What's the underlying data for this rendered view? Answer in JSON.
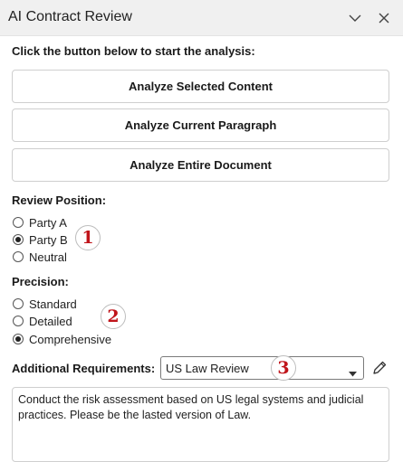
{
  "window": {
    "title": "AI Contract Review",
    "icons": [
      "chevron-down-icon",
      "close-icon"
    ]
  },
  "instruction": "Click the button below to start the analysis:",
  "buttons": {
    "analyze_selected": "Analyze Selected Content",
    "analyze_paragraph": "Analyze Current Paragraph",
    "analyze_document": "Analyze Entire Document"
  },
  "review_position": {
    "label": "Review Position:",
    "options": [
      "Party A",
      "Party B",
      "Neutral"
    ],
    "selected": "Party B"
  },
  "precision": {
    "label": "Precision:",
    "options": [
      "Standard",
      "Detailed",
      "Comprehensive"
    ],
    "selected": "Comprehensive"
  },
  "additional_requirements": {
    "label": "Additional Requirements:",
    "select_value": "US Law Review",
    "text": "Conduct the risk assessment based on US legal systems and judicial practices. Please be the lasted version of Law."
  },
  "annotations": [
    "1",
    "2",
    "3"
  ],
  "colors": {
    "annotation_red": "#c0141a",
    "titlebar_bg": "#f0f0f0"
  }
}
